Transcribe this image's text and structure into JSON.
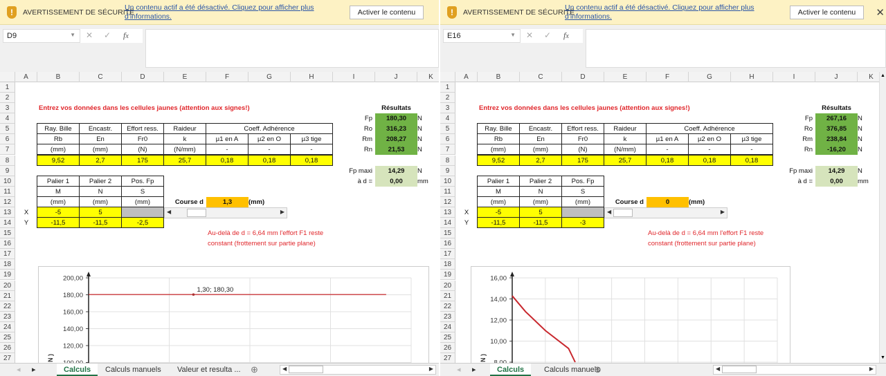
{
  "colors": {
    "yellow": "#ffff00",
    "green": "#70b245",
    "light_green": "#d6e4bc",
    "orange": "#ffc000",
    "red": "#e0262b",
    "tab_active": "#217346"
  },
  "columns": [
    "A",
    "B",
    "C",
    "D",
    "E",
    "F",
    "G",
    "H",
    "I",
    "J",
    "K"
  ],
  "rows": [
    "1",
    "2",
    "3",
    "4",
    "5",
    "6",
    "7",
    "8",
    "9",
    "10",
    "11",
    "12",
    "13",
    "14",
    "15",
    "16",
    "17",
    "18",
    "19",
    "20",
    "21",
    "22",
    "23",
    "24",
    "25",
    "26",
    "27"
  ],
  "panes": [
    {
      "warning": {
        "title": "AVERTISSEMENT DE SÉCURITÉ",
        "message": "Un contenu actif a été désactivé. Cliquez pour afficher plus d'informations.",
        "button": "Activer le contenu",
        "close": ""
      },
      "name_box": "D9",
      "formula": "",
      "cells": [
        {
          "ref": "B3",
          "v": "Entrez vos données dans les cellules jaunes (attention aux signes!)",
          "c": "redb"
        },
        {
          "ref": "J3",
          "v": "Résultats",
          "c": "bold"
        },
        {
          "ref": "B5",
          "v": "Ray. Bille",
          "c": "b"
        },
        {
          "ref": "C5",
          "v": "Encastr.",
          "c": "b"
        },
        {
          "ref": "D5",
          "v": "Effort ress.",
          "c": "b"
        },
        {
          "ref": "E5",
          "v": "Raideur",
          "c": "b"
        },
        {
          "ref": "F5",
          "v": "Coeff. Adhérence",
          "c": "b",
          "span": 3
        },
        {
          "ref": "B6",
          "v": "Rb",
          "c": "b"
        },
        {
          "ref": "C6",
          "v": "En",
          "c": "b"
        },
        {
          "ref": "D6",
          "v": "Fr0",
          "c": "b"
        },
        {
          "ref": "E6",
          "v": "k",
          "c": "b"
        },
        {
          "ref": "F6",
          "v": "µ1 en A",
          "c": "b"
        },
        {
          "ref": "G6",
          "v": "µ2 en O",
          "c": "b"
        },
        {
          "ref": "H6",
          "v": "µ3 tige",
          "c": "b"
        },
        {
          "ref": "B7",
          "v": "(mm)",
          "c": "b"
        },
        {
          "ref": "C7",
          "v": "(mm)",
          "c": "b"
        },
        {
          "ref": "D7",
          "v": "(N)",
          "c": "b"
        },
        {
          "ref": "E7",
          "v": "(N/mm)",
          "c": "b"
        },
        {
          "ref": "F7",
          "v": "-",
          "c": "b"
        },
        {
          "ref": "G7",
          "v": "-",
          "c": "b"
        },
        {
          "ref": "H7",
          "v": "-",
          "c": "b"
        },
        {
          "ref": "B8",
          "v": "9,52",
          "c": "b y"
        },
        {
          "ref": "C8",
          "v": "2,7",
          "c": "b y"
        },
        {
          "ref": "D8",
          "v": "175",
          "c": "b y"
        },
        {
          "ref": "E8",
          "v": "25,7",
          "c": "b y"
        },
        {
          "ref": "F8",
          "v": "0,18",
          "c": "b y"
        },
        {
          "ref": "G8",
          "v": "0,18",
          "c": "b y"
        },
        {
          "ref": "H8",
          "v": "0,18",
          "c": "b y"
        },
        {
          "ref": "I4",
          "v": "Fp",
          "c": "r"
        },
        {
          "ref": "J4",
          "v": "180,30",
          "c": "g"
        },
        {
          "ref": "K4",
          "v": "N",
          "c": "l"
        },
        {
          "ref": "I5",
          "v": "Ro",
          "c": "r"
        },
        {
          "ref": "J5",
          "v": "316,23",
          "c": "g"
        },
        {
          "ref": "K5",
          "v": "N",
          "c": "l"
        },
        {
          "ref": "I6",
          "v": "Rm",
          "c": "r"
        },
        {
          "ref": "J6",
          "v": "208,27",
          "c": "g"
        },
        {
          "ref": "K6",
          "v": "N",
          "c": "l"
        },
        {
          "ref": "I7",
          "v": "Rn",
          "c": "r"
        },
        {
          "ref": "J7",
          "v": "21,53",
          "c": "g"
        },
        {
          "ref": "K7",
          "v": "N",
          "c": "l"
        },
        {
          "ref": "I9",
          "v": "Fp maxi",
          "c": "r"
        },
        {
          "ref": "J9",
          "v": "14,29",
          "c": "lg"
        },
        {
          "ref": "K9",
          "v": "N",
          "c": "l"
        },
        {
          "ref": "I10",
          "v": "à d =",
          "c": "r"
        },
        {
          "ref": "J10",
          "v": "0,00",
          "c": "lg"
        },
        {
          "ref": "K10",
          "v": "mm",
          "c": "l"
        },
        {
          "ref": "B10",
          "v": "Palier 1",
          "c": "b"
        },
        {
          "ref": "C10",
          "v": "Palier 2",
          "c": "b"
        },
        {
          "ref": "D10",
          "v": "Pos. Fp",
          "c": "b"
        },
        {
          "ref": "B11",
          "v": "M",
          "c": "b"
        },
        {
          "ref": "C11",
          "v": "N",
          "c": "b"
        },
        {
          "ref": "D11",
          "v": "S",
          "c": "b"
        },
        {
          "ref": "B12",
          "v": "(mm)",
          "c": "b"
        },
        {
          "ref": "C12",
          "v": "(mm)",
          "c": "b"
        },
        {
          "ref": "D12",
          "v": "(mm)",
          "c": "b"
        },
        {
          "ref": "A13",
          "v": "X",
          "c": ""
        },
        {
          "ref": "B13",
          "v": "-5",
          "c": "b y"
        },
        {
          "ref": "C13",
          "v": "5",
          "c": "b y"
        },
        {
          "ref": "D13",
          "v": "",
          "c": "b gy"
        },
        {
          "ref": "A14",
          "v": "Y",
          "c": ""
        },
        {
          "ref": "B14",
          "v": "-11,5",
          "c": "b y"
        },
        {
          "ref": "C14",
          "v": "-11,5",
          "c": "b y"
        },
        {
          "ref": "D14",
          "v": "-2,5",
          "c": "b y"
        },
        {
          "ref": "E12",
          "v": "Course d",
          "c": "r bold"
        },
        {
          "ref": "F12",
          "v": "1,3",
          "c": "or"
        },
        {
          "ref": "G12",
          "v": "(mm)",
          "c": "l bold"
        },
        {
          "ref": "F15",
          "v": "Au-delà de d = 6,64 mm l'effort F1 reste",
          "c": "red"
        },
        {
          "ref": "F16",
          "v": "constant (frottement sur partie plane)",
          "c": "red"
        }
      ],
      "course_slider": {
        "value": 1.3,
        "min": 0,
        "max": 8
      },
      "chart_data": {
        "type": "line",
        "title": "",
        "xlabel": "",
        "ylabel": "N )",
        "ylim": [
          100,
          200
        ],
        "xlim": [
          0,
          4
        ],
        "yticks": [
          "200,00",
          "180,00",
          "160,00",
          "140,00",
          "120,00",
          "100,00"
        ],
        "x": [
          0,
          1.3,
          3.69
        ],
        "y": [
          180.3,
          180.3,
          180.3
        ],
        "annotation": "1,30; 180,30",
        "annotation_x": 1.3,
        "annotation_y": 180.3,
        "grid": true
      },
      "tabs": [
        {
          "label": "Calculs",
          "active": true
        },
        {
          "label": "Calculs manuels"
        },
        {
          "label": "Valeur et resulta ..."
        }
      ]
    },
    {
      "warning": {
        "title": "AVERTISSEMENT DE SÉCURITÉ",
        "message": "Un contenu actif a été désactivé. Cliquez pour afficher plus d'informations.",
        "button": "Activer le contenu",
        "close": "✕"
      },
      "name_box": "E16",
      "formula": "",
      "cells": [
        {
          "ref": "B3",
          "v": "Entrez vos données dans les cellules jaunes (attention aux signes!)",
          "c": "redb"
        },
        {
          "ref": "J3",
          "v": "Résultats",
          "c": "bold"
        },
        {
          "ref": "B5",
          "v": "Ray. Bille",
          "c": "b"
        },
        {
          "ref": "C5",
          "v": "Encastr.",
          "c": "b"
        },
        {
          "ref": "D5",
          "v": "Effort ress.",
          "c": "b"
        },
        {
          "ref": "E5",
          "v": "Raideur",
          "c": "b"
        },
        {
          "ref": "F5",
          "v": "Coeff. Adhérence",
          "c": "b",
          "span": 3
        },
        {
          "ref": "B6",
          "v": "Rb",
          "c": "b"
        },
        {
          "ref": "C6",
          "v": "En",
          "c": "b"
        },
        {
          "ref": "D6",
          "v": "Fr0",
          "c": "b"
        },
        {
          "ref": "E6",
          "v": "k",
          "c": "b"
        },
        {
          "ref": "F6",
          "v": "µ1 en A",
          "c": "b"
        },
        {
          "ref": "G6",
          "v": "µ2 en O",
          "c": "b"
        },
        {
          "ref": "H6",
          "v": "µ3 tige",
          "c": "b"
        },
        {
          "ref": "B7",
          "v": "(mm)",
          "c": "b"
        },
        {
          "ref": "C7",
          "v": "(mm)",
          "c": "b"
        },
        {
          "ref": "D7",
          "v": "(N)",
          "c": "b"
        },
        {
          "ref": "E7",
          "v": "(N/mm)",
          "c": "b"
        },
        {
          "ref": "F7",
          "v": "-",
          "c": "b"
        },
        {
          "ref": "G7",
          "v": "-",
          "c": "b"
        },
        {
          "ref": "H7",
          "v": "-",
          "c": "b"
        },
        {
          "ref": "B8",
          "v": "9,52",
          "c": "b y"
        },
        {
          "ref": "C8",
          "v": "2,7",
          "c": "b y"
        },
        {
          "ref": "D8",
          "v": "175",
          "c": "b y"
        },
        {
          "ref": "E8",
          "v": "25,7",
          "c": "b y"
        },
        {
          "ref": "F8",
          "v": "0,18",
          "c": "b y"
        },
        {
          "ref": "G8",
          "v": "0,18",
          "c": "b y"
        },
        {
          "ref": "H8",
          "v": "0,18",
          "c": "b y"
        },
        {
          "ref": "I4",
          "v": "Fp",
          "c": "r"
        },
        {
          "ref": "J4",
          "v": "267,16",
          "c": "g"
        },
        {
          "ref": "K4",
          "v": "N",
          "c": "l"
        },
        {
          "ref": "I5",
          "v": "Ro",
          "c": "r"
        },
        {
          "ref": "J5",
          "v": "376,85",
          "c": "g"
        },
        {
          "ref": "K5",
          "v": "N",
          "c": "l"
        },
        {
          "ref": "I6",
          "v": "Rm",
          "c": "r"
        },
        {
          "ref": "J6",
          "v": "238,84",
          "c": "g"
        },
        {
          "ref": "K6",
          "v": "N",
          "c": "l"
        },
        {
          "ref": "I7",
          "v": "Rn",
          "c": "r"
        },
        {
          "ref": "J7",
          "v": "-16,20",
          "c": "g"
        },
        {
          "ref": "K7",
          "v": "N",
          "c": "l"
        },
        {
          "ref": "I9",
          "v": "Fp maxi",
          "c": "r"
        },
        {
          "ref": "J9",
          "v": "14,29",
          "c": "lg"
        },
        {
          "ref": "K9",
          "v": "N",
          "c": "l"
        },
        {
          "ref": "I10",
          "v": "à d =",
          "c": "r"
        },
        {
          "ref": "J10",
          "v": "0,00",
          "c": "lg"
        },
        {
          "ref": "K10",
          "v": "mm",
          "c": "l"
        },
        {
          "ref": "B10",
          "v": "Palier 1",
          "c": "b"
        },
        {
          "ref": "C10",
          "v": "Palier 2",
          "c": "b"
        },
        {
          "ref": "D10",
          "v": "Pos. Fp",
          "c": "b"
        },
        {
          "ref": "B11",
          "v": "M",
          "c": "b"
        },
        {
          "ref": "C11",
          "v": "N",
          "c": "b"
        },
        {
          "ref": "D11",
          "v": "S",
          "c": "b"
        },
        {
          "ref": "B12",
          "v": "(mm)",
          "c": "b"
        },
        {
          "ref": "C12",
          "v": "(mm)",
          "c": "b"
        },
        {
          "ref": "D12",
          "v": "(mm)",
          "c": "b"
        },
        {
          "ref": "A13",
          "v": "X",
          "c": ""
        },
        {
          "ref": "B13",
          "v": "-5",
          "c": "b y"
        },
        {
          "ref": "C13",
          "v": "5",
          "c": "b y"
        },
        {
          "ref": "D13",
          "v": "",
          "c": "b gy"
        },
        {
          "ref": "A14",
          "v": "Y",
          "c": ""
        },
        {
          "ref": "B14",
          "v": "-11,5",
          "c": "b y"
        },
        {
          "ref": "C14",
          "v": "-11,5",
          "c": "b y"
        },
        {
          "ref": "D14",
          "v": "-3",
          "c": "b y"
        },
        {
          "ref": "E12",
          "v": "Course d",
          "c": "r bold"
        },
        {
          "ref": "F12",
          "v": "0",
          "c": "or"
        },
        {
          "ref": "G12",
          "v": "(mm)",
          "c": "l bold"
        },
        {
          "ref": "F15",
          "v": "Au-delà de d = 6,64 mm l'effort F1 reste",
          "c": "red"
        },
        {
          "ref": "F16",
          "v": "constant (frottement sur partie plane)",
          "c": "red"
        }
      ],
      "course_slider": {
        "value": 0,
        "min": 0,
        "max": 8
      },
      "chart_data": {
        "type": "line",
        "title": "",
        "xlabel": "",
        "ylabel": "N )",
        "ylim": [
          8,
          16
        ],
        "xlim": [
          0,
          8
        ],
        "yticks": [
          "16,00",
          "14,00",
          "12,00",
          "10,00",
          "8,00"
        ],
        "x": [
          0,
          0.4,
          1.0,
          1.7,
          1.9
        ],
        "y": [
          14.29,
          12.8,
          11.0,
          9.3,
          8.0
        ],
        "grid": true
      },
      "tabs": [
        {
          "label": "Calculs",
          "active": true
        },
        {
          "label": "Calculs manuels"
        }
      ]
    }
  ]
}
